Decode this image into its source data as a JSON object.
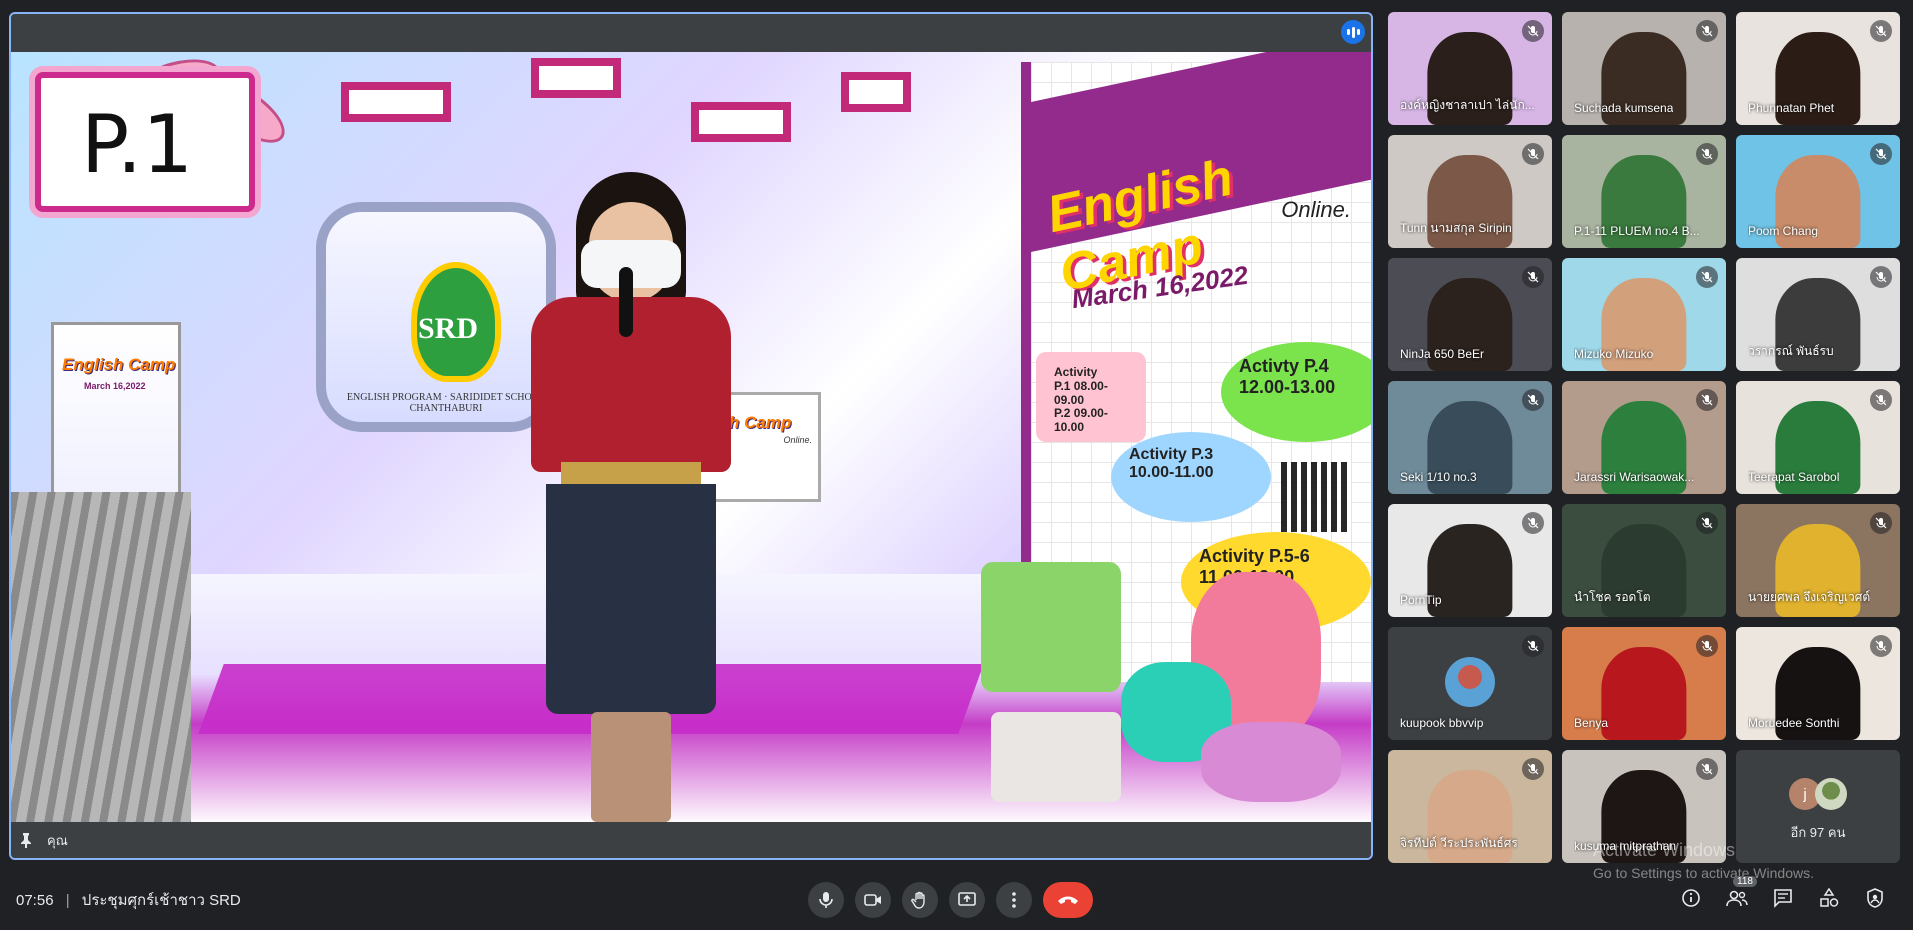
{
  "meeting": {
    "time": "07:56",
    "separator": "|",
    "title": "ประชุมศุกร์เช้าชาว SRD"
  },
  "presenter": {
    "name": "คุณ",
    "pin_icon": "pin-icon",
    "scene": {
      "sign_text": "P.1",
      "school_logo_text": "SRD",
      "school_caption": "ENGLISH PROGRAM · SARIDIDET SCHOOL CHANTHABURI",
      "poster_title": "English Camp",
      "poster_online": "Online.",
      "poster_date": "March 16,2022",
      "activity_p1_label": "Activity",
      "activity_p1_line1": "P.1 08.00-09.00",
      "activity_p1_line2": "P.2 09.00-10.00",
      "activity_p4_label": "Activty P.4",
      "activity_p4_time": "12.00-13.00",
      "activity_p3_label": "Activity P.3",
      "activity_p3_time": "10.00-11.00",
      "activity_p56_label": "Activity P.5-6",
      "activity_p56_time": "11.00-12.00"
    }
  },
  "participants": [
    {
      "name": "องค์หญิงชาลาเปา ไล่นัก...",
      "scene": "#d7b6e6",
      "head": "#2a1f1a"
    },
    {
      "name": "Suchada kumsena",
      "scene": "#b8b2ae",
      "head": "#3a2c22"
    },
    {
      "name": "Phunnatan Phet",
      "scene": "#e9e3df",
      "head": "#2b1d16"
    },
    {
      "name": "Tunn นามสกุล Siripin",
      "scene": "#cfc9c5",
      "head": "#7b5847"
    },
    {
      "name": "P.1-11 PLUEM no.4 B...",
      "scene": "#a9b4a0",
      "head": "#3a7a3e"
    },
    {
      "name": "Poom Chang",
      "scene": "#6fc3e6",
      "head": "#c88c6a"
    },
    {
      "name": "NinJa 650 BeEr",
      "scene": "#4c4c55",
      "head": "#2b211d"
    },
    {
      "name": "Mizuko Mizuko",
      "scene": "#9fd8e9",
      "head": "#d3a07c"
    },
    {
      "name": "วรากรณ์ พันธ์รบ",
      "scene": "#dedede",
      "head": "#3c3c3c"
    },
    {
      "name": "Seki 1/10 no.3",
      "scene": "#6f8b9a",
      "head": "#384c59"
    },
    {
      "name": "Jarassri Warisaowak...",
      "scene": "#b49c8c",
      "head": "#2d7f3e"
    },
    {
      "name": "Teerapat Sarobol",
      "scene": "#e8e2dc",
      "head": "#2a7c3c"
    },
    {
      "name": "PornTip",
      "scene": "#e8e8e8",
      "head": "#2a2421"
    },
    {
      "name": "นำโชค รอดโต",
      "scene": "#3a4d3f",
      "head": "#2c3b2f"
    },
    {
      "name": "นายยศพล จึงเจริญเวศต์",
      "scene": "#8b7460",
      "head": "#e0b22e"
    },
    {
      "name": "kuupook bbvvip",
      "scene": "#3c4043",
      "head": "none",
      "avatar": true
    },
    {
      "name": "Benya",
      "scene": "#d77c4b",
      "head": "#b8171d"
    },
    {
      "name": "Moruedee Sonthi",
      "scene": "#ede6de",
      "head": "#161212"
    },
    {
      "name": "จิรทีปต์ วีระประพันธ์ศร",
      "scene": "#cbb79d",
      "head": "#d6a98a"
    },
    {
      "name": "kusuma mitprathan",
      "scene": "#c9c3bd",
      "head": "#1e1614"
    }
  ],
  "more_tile": {
    "initial": "j",
    "label": "อีก 97 คน"
  },
  "controls": {
    "mic_icon": "mic-icon",
    "camera_icon": "camera-icon",
    "raise_hand_icon": "raise-hand-icon",
    "present_icon": "present-screen-icon",
    "more_icon": "more-options-icon",
    "end_call_icon": "end-call-icon"
  },
  "right_controls": {
    "info_icon": "info-icon",
    "people_icon": "people-icon",
    "people_count": "118",
    "chat_icon": "chat-icon",
    "activities_icon": "activities-icon",
    "host_controls_icon": "host-controls-icon"
  },
  "watermark": {
    "line1": "Activate Windows",
    "line2": "Go to Settings to activate Windows."
  },
  "colors": {
    "background": "#202124",
    "tile": "#3c4043",
    "active_border": "#8ab4f8",
    "end_call": "#ea4335",
    "speaking": "#1a73e8"
  }
}
